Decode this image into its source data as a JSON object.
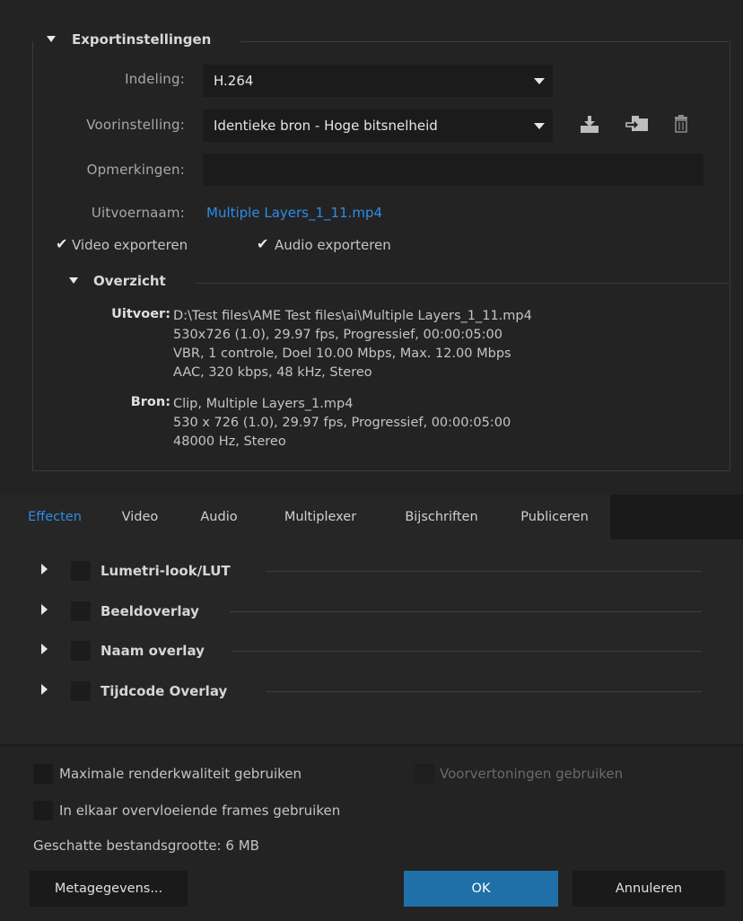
{
  "export": {
    "section_title": "Exportinstellingen",
    "format_label": "Indeling:",
    "format_value": "H.264",
    "preset_label": "Voorinstelling:",
    "preset_value": "Identieke bron - Hoge bitsnelheid",
    "comments_label": "Opmerkingen:",
    "comments_value": "",
    "output_label": "Uitvoernaam:",
    "output_value": "Multiple Layers_1_11.mp4",
    "video_export_label": "Video exporteren",
    "audio_export_label": "Audio exporteren",
    "video_export_checked": true,
    "audio_export_checked": true
  },
  "summary": {
    "title": "Overzicht",
    "output_label": "Uitvoer:",
    "output_lines": [
      "D:\\Test files\\AME Test files\\ai\\Multiple Layers_1_11.mp4",
      "530x726 (1.0), 29.97 fps, Progressief, 00:00:05:00",
      "VBR, 1 controle, Doel 10.00 Mbps, Max. 12.00 Mbps",
      "AAC, 320 kbps, 48 kHz, Stereo"
    ],
    "source_label": "Bron:",
    "source_lines": [
      "Clip, Multiple Layers_1.mp4",
      "530 x 726 (1.0), 29.97 fps, Progressief, 00:00:05:00",
      "48000 Hz, Stereo"
    ]
  },
  "tabs": [
    "Effecten",
    "Video",
    "Audio",
    "Multiplexer",
    "Bijschriften",
    "Publiceren"
  ],
  "active_tab": "Effecten",
  "effects": [
    "Lumetri-look/LUT",
    "Beeldoverlay",
    "Naam overlay",
    "Tijdcode Overlay"
  ],
  "options": {
    "max_render_label": "Maximale renderkwaliteit gebruiken",
    "previews_label": "Voorvertoningen gebruiken",
    "frame_blend_label": "In elkaar overvloeiende frames gebruiken",
    "filesize_label": "Geschatte bestandsgrootte:",
    "filesize_value": "6 MB"
  },
  "buttons": {
    "metadata": "Metagegevens...",
    "ok": "OK",
    "cancel": "Annuleren"
  },
  "colors": {
    "accent": "#2d8ceb",
    "primary_button": "#1f6fa8",
    "background": "#232323"
  }
}
